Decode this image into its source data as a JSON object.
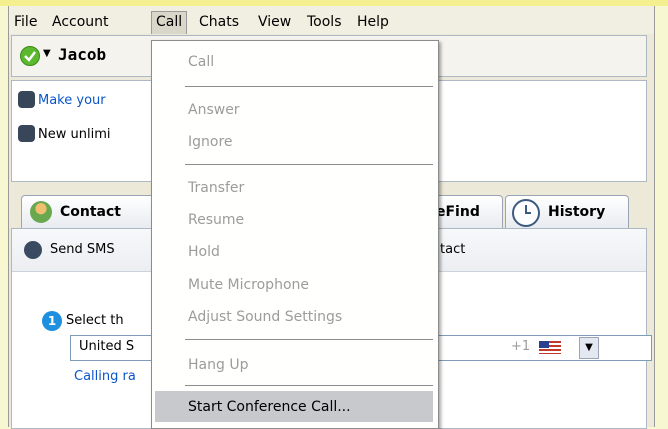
{
  "menubar": {
    "items": [
      "File",
      "Account",
      "Call",
      "Chats",
      "View",
      "Tools",
      "Help"
    ]
  },
  "profile": {
    "name": "Jacob"
  },
  "promos": {
    "line1": "Make your",
    "line2": "New unlimi"
  },
  "tabs": {
    "contacts": "Contact",
    "skypefind": "eFind",
    "history": "History"
  },
  "panel": {
    "send_sms": "Send SMS",
    "add_contact": "tact",
    "step_label": "Select th",
    "country_value": "United S",
    "country_code": "+1",
    "calling_rates": "Calling ra"
  },
  "call_menu": {
    "items": [
      {
        "label": "Call",
        "enabled": false
      },
      {
        "label": "Answer",
        "enabled": false
      },
      {
        "label": "Ignore",
        "enabled": false
      },
      {
        "label": "Transfer",
        "enabled": false
      },
      {
        "label": "Resume",
        "enabled": false
      },
      {
        "label": "Hold",
        "enabled": false
      },
      {
        "label": "Mute Microphone",
        "enabled": false
      },
      {
        "label": "Adjust Sound Settings",
        "enabled": false
      },
      {
        "label": "Hang Up",
        "enabled": false
      },
      {
        "label": "Start Conference Call...",
        "enabled": true,
        "highlighted": true
      }
    ]
  },
  "colors": {
    "link": "#0a56c8",
    "disabled_text": "#9c9c9c",
    "highlight": "#c7c9cd",
    "status_online": "#5cb82f",
    "step_badge": "#1f8fe0"
  }
}
